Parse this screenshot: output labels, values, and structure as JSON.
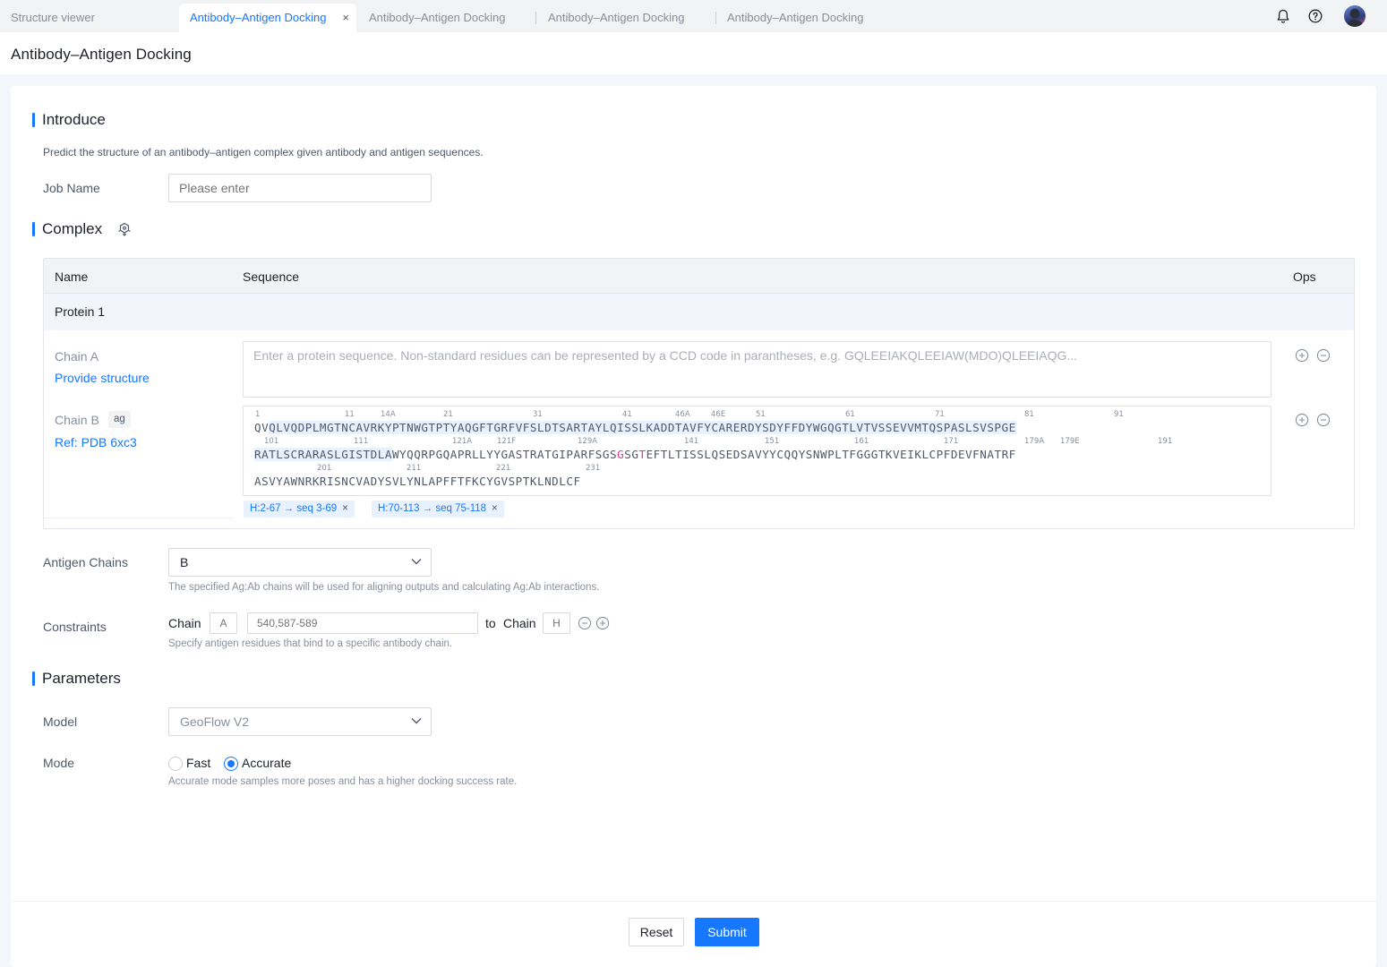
{
  "tabs": [
    {
      "label": "Structure viewer"
    },
    {
      "label": "Antibody–Antigen Docking",
      "close": "×"
    },
    {
      "label": "Antibody–Antigen Docking"
    },
    {
      "label": "Antibody–Antigen Docking"
    },
    {
      "label": "Antibody–Antigen Docking"
    }
  ],
  "topbar": {
    "icons": [
      "bell-icon",
      "help-icon",
      "user-avatar"
    ]
  },
  "page": {
    "title": "Antibody–Antigen Docking"
  },
  "introduce": {
    "title": "Introduce",
    "description": "Predict the structure of an antibody–antigen complex given antibody and antigen sequences.",
    "job_name_label": "Job Name",
    "job_name_placeholder": "Please enter"
  },
  "complex": {
    "title": "Complex",
    "icon": "molecule-upload-icon",
    "columns": [
      "Name",
      "Sequence",
      "Ops"
    ],
    "group": "Protein 1",
    "chain_a": {
      "name": "Chain A",
      "link": "Provide structure",
      "placeholder": "Enter a protein sequence. Non-standard residues can be represented by a CCD code in parantheses, e.g. GQLEEIAKQLEEIAW(MDO)QLEEIAQG..."
    },
    "chain_b": {
      "name": "Chain B",
      "tag": "ag",
      "link": "Ref: PDB 6xc3",
      "line1_pre": "QV",
      "line1_hl": "QLVQDPLMGTNCAVRKYPTNWGTPTYAQGFTGRFVFSLDTSARTAYLQISSLKADDTAVFYCARERDYSDYFFDYWGQGTLVTVSSEVVMTQSPASLSVSPGE",
      "line2_hl": "RATLSCRARASLGISTDLA",
      "line2_a": "WYQQRPGQAPRLLYYGASTRATGIPARFSGS",
      "line2_g": "G",
      "line2_b": "SG",
      "line2_t": "T",
      "line2_c": "EFTLTISSLQSEDSAVYYCQQYSNWPLTFGGGTKVEIKLCPFDEVFNATRF",
      "line3": "ASVYAWNRKRISNCVADYSVLYNLAPFFTFKCYGVSPTKLNDLCF",
      "numbers_row1": [
        "1",
        "11",
        "14A",
        "21",
        "31",
        "41",
        "46A",
        "46E",
        "51",
        "61",
        "71",
        "81",
        "91"
      ],
      "numbers_row2": [
        "101",
        "111",
        "121A",
        "121F",
        "129A",
        "141",
        "151",
        "161",
        "171",
        "179A",
        "179E",
        "191"
      ],
      "numbers_row3": [
        "201",
        "211",
        "221",
        "231"
      ],
      "mappings": [
        {
          "label": "H:2-67 → seq 3-69",
          "x": "×"
        },
        {
          "label": "H:70-113 → seq 75-118",
          "x": "×"
        }
      ]
    }
  },
  "antigen_chains": {
    "label": "Antigen Chains",
    "value": "B",
    "hint": "The specified Ag:Ab chains will be used for aligning outputs and calculating Ag:Ab interactions."
  },
  "constraints": {
    "label": "Constraints",
    "chain_label": "Chain",
    "chain_placeholder": "A",
    "residues_placeholder": "540,587-589",
    "to_label": "to",
    "to_chain_label": "Chain",
    "to_chain_placeholder": "H",
    "hint": "Specify antigen residues that bind to a specific antibody chain."
  },
  "parameters": {
    "title": "Parameters",
    "model_label": "Model",
    "model_value": "GeoFlow V2",
    "mode_label": "Mode",
    "mode_options": [
      "Fast",
      "Accurate"
    ],
    "mode_selected": "Accurate",
    "mode_hint": "Accurate mode samples more poses and has a higher docking success rate."
  },
  "footer": {
    "reset": "Reset",
    "submit": "Submit"
  },
  "colors": {
    "accent": "#1677ff",
    "highlight": "#e8f1ff",
    "pink_residue": "#e5359a"
  }
}
